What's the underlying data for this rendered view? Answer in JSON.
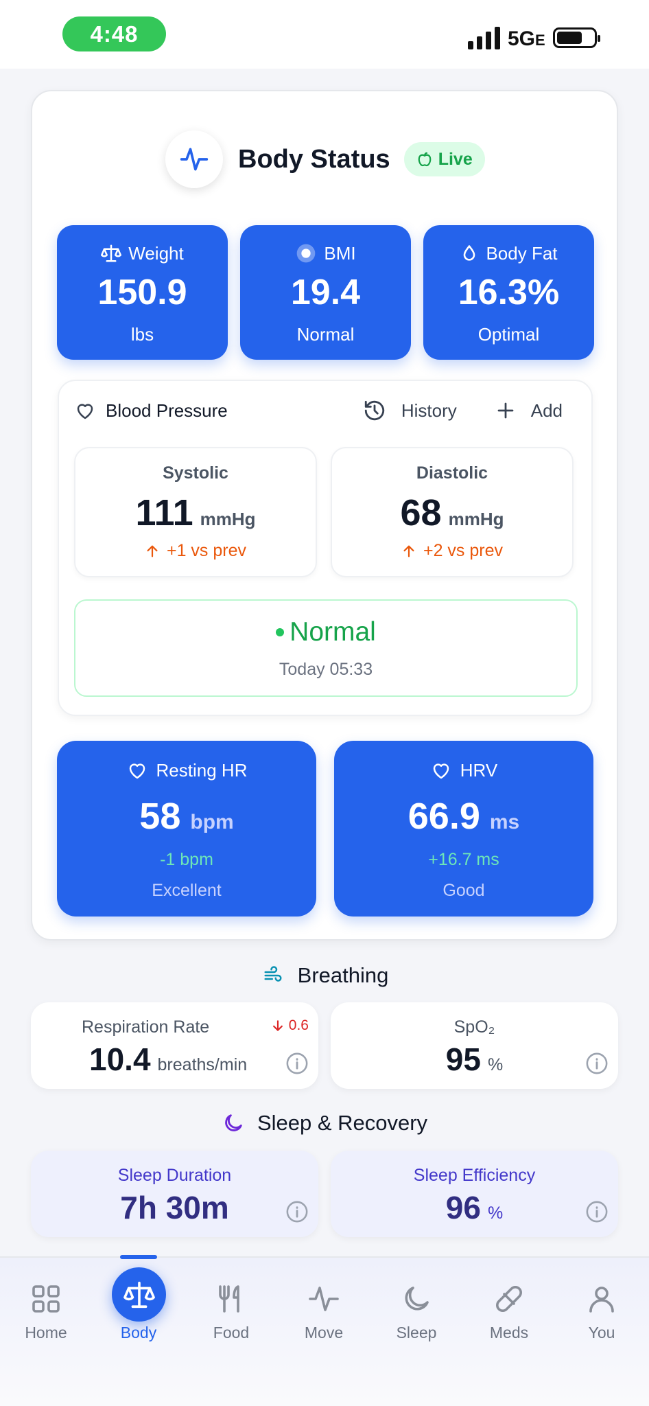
{
  "status_bar": {
    "time": "4:48",
    "network": "5G",
    "network_suffix": "E"
  },
  "header": {
    "title": "Body Status",
    "badge": "Live",
    "icon": "activity-icon",
    "badge_icon": "apple-icon"
  },
  "metrics": [
    {
      "label": "Weight",
      "value": "150.9",
      "sub": "lbs",
      "icon": "scale-icon"
    },
    {
      "label": "BMI",
      "value": "19.4",
      "sub": "Normal",
      "icon": "target-icon"
    },
    {
      "label": "Body Fat",
      "value": "16.3%",
      "sub": "Optimal",
      "icon": "droplet-icon"
    }
  ],
  "blood_pressure": {
    "title": "Blood Pressure",
    "history_label": "History",
    "add_label": "Add",
    "systolic": {
      "label": "Systolic",
      "value": "111",
      "unit": "mmHg",
      "change": "+1 vs prev"
    },
    "diastolic": {
      "label": "Diastolic",
      "value": "68",
      "unit": "mmHg",
      "change": "+2 vs prev"
    },
    "status": "Normal",
    "timestamp": "Today 05:33"
  },
  "heart": [
    {
      "label": "Resting HR",
      "value": "58",
      "unit": "bpm",
      "change": "-1 bpm",
      "rating": "Excellent"
    },
    {
      "label": "HRV",
      "value": "66.9",
      "unit": "ms",
      "change": "+16.7 ms",
      "rating": "Good"
    }
  ],
  "breathing": {
    "title": "Breathing",
    "respiration": {
      "label": "Respiration Rate",
      "value": "10.4",
      "unit": "breaths/min",
      "delta": "0.6"
    },
    "spo2": {
      "label": "SpO₂",
      "value": "95",
      "unit": "%"
    }
  },
  "sleep": {
    "title": "Sleep & Recovery",
    "duration": {
      "label": "Sleep Duration",
      "value": "7h 30m"
    },
    "efficiency": {
      "label": "Sleep Efficiency",
      "value": "96",
      "unit": "%"
    }
  },
  "nav": [
    {
      "label": "Home",
      "icon": "grid-icon"
    },
    {
      "label": "Body",
      "icon": "scale-icon",
      "active": true
    },
    {
      "label": "Food",
      "icon": "utensils-icon"
    },
    {
      "label": "Move",
      "icon": "activity-icon"
    },
    {
      "label": "Sleep",
      "icon": "moon-icon"
    },
    {
      "label": "Meds",
      "icon": "pill-icon"
    },
    {
      "label": "You",
      "icon": "user-icon"
    }
  ],
  "colors": {
    "accent": "#2563eb",
    "success": "#16a34a",
    "warning": "#ea580c",
    "danger": "#dc2626",
    "live_badge_bg": "#dcfce7"
  }
}
